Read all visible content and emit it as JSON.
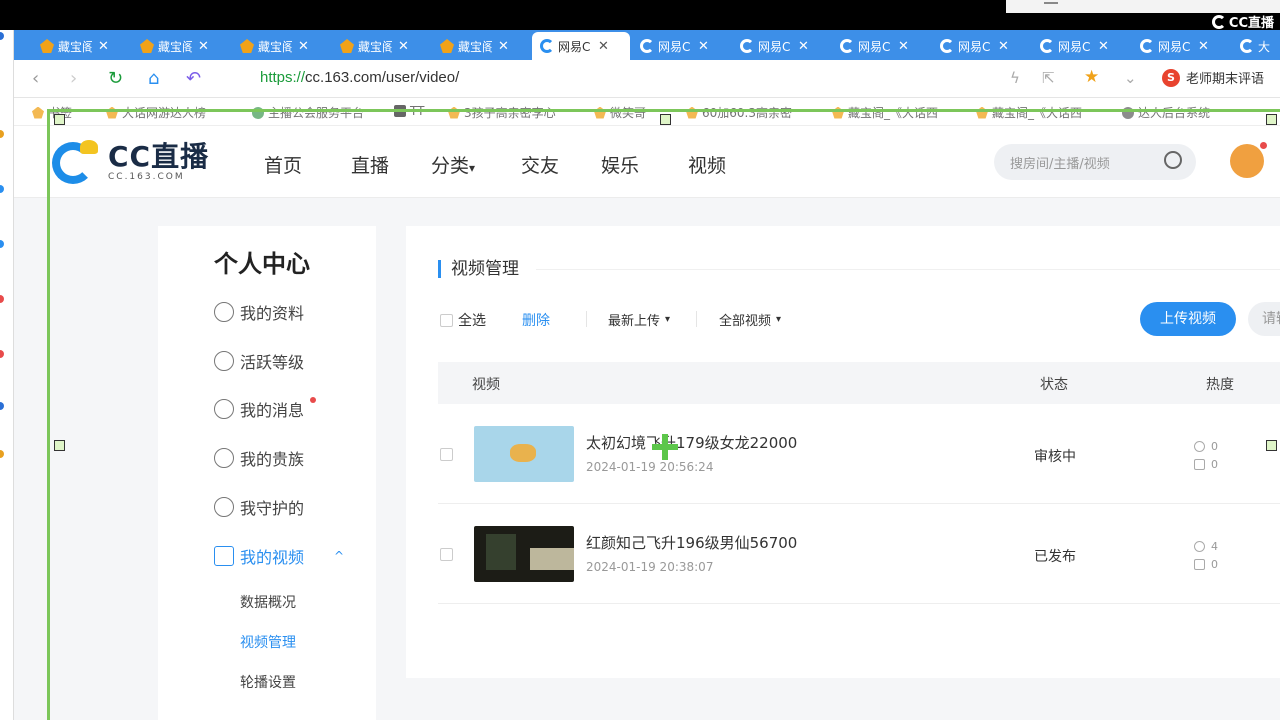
{
  "watermark": {
    "text": "CC直播"
  },
  "browser": {
    "tabs": [
      {
        "title": "藏宝阁",
        "icon": "treasure-icon",
        "active": false
      },
      {
        "title": "藏宝阁",
        "icon": "treasure-icon",
        "active": false
      },
      {
        "title": "藏宝阁",
        "icon": "treasure-icon",
        "active": false
      },
      {
        "title": "藏宝阁",
        "icon": "treasure-icon",
        "active": false
      },
      {
        "title": "藏宝阁",
        "icon": "treasure-icon",
        "active": false
      },
      {
        "title": "网易C",
        "icon": "cc-icon",
        "active": true
      },
      {
        "title": "网易C",
        "icon": "cc-icon",
        "active": false
      },
      {
        "title": "网易C",
        "icon": "cc-icon",
        "active": false
      },
      {
        "title": "网易C",
        "icon": "cc-icon",
        "active": false
      },
      {
        "title": "网易C",
        "icon": "cc-icon",
        "active": false
      },
      {
        "title": "网易C",
        "icon": "cc-icon",
        "active": false
      },
      {
        "title": "网易C",
        "icon": "cc-icon",
        "active": false
      },
      {
        "title": "大",
        "icon": "cc-icon",
        "active": false
      }
    ],
    "url_scheme": "https://",
    "url_rest": "cc.163.com/user/video/",
    "search_engine_text": "老师期末评语",
    "bookmarks": [
      "书签",
      "大话网游达人榜",
      "主播公会服务平台",
      "TT",
      "3孩子高亲密李心",
      "微笑哥",
      "60加60.3高亲密",
      "藏宝阁_《大话西",
      "藏宝阁_《大话西",
      "达人后台系统"
    ]
  },
  "site": {
    "logo_main": "CC直播",
    "logo_sub": "CC.163.COM",
    "nav": [
      "首页",
      "直播",
      "分类",
      "交友",
      "娱乐",
      "视频"
    ],
    "nav_dropdown_mark": "▾",
    "search_placeholder": "搜房间/主播/视频"
  },
  "sidebar": {
    "title": "个人中心",
    "items": [
      {
        "label": "我的资料",
        "icon": "user-icon"
      },
      {
        "label": "活跃等级",
        "icon": "flame-icon"
      },
      {
        "label": "我的消息",
        "icon": "message-icon"
      },
      {
        "label": "我的贵族",
        "icon": "crown-icon"
      },
      {
        "label": "我守护的",
        "icon": "guard-icon"
      },
      {
        "label": "我的视频",
        "icon": "video-icon"
      }
    ],
    "video_submenu": [
      "数据概况",
      "视频管理",
      "轮播设置"
    ],
    "expand_mark": "^"
  },
  "main": {
    "title": "视频管理",
    "toolbar": {
      "select_all": "全选",
      "delete": "删除",
      "sort": "最新上传",
      "filter": "全部视频",
      "dropdown_mark": "▾",
      "upload": "上传视频",
      "more": "请输"
    },
    "columns": {
      "video": "视频",
      "status": "状态",
      "heat": "热度"
    },
    "rows": [
      {
        "title": "太初幻境飞升179级女龙22000",
        "date": "2024-01-19 20:56:24",
        "status": "审核中",
        "plays": "0",
        "comments": "0"
      },
      {
        "title": "红颜知己飞升196级男仙56700",
        "date": "2024-01-19 20:38:07",
        "status": "已发布",
        "plays": "4",
        "comments": "0"
      }
    ]
  },
  "colors": {
    "brand_blue": "#2a8ff0",
    "tab_bar": "#3d8fe8",
    "selection_green": "#7cc65a"
  }
}
